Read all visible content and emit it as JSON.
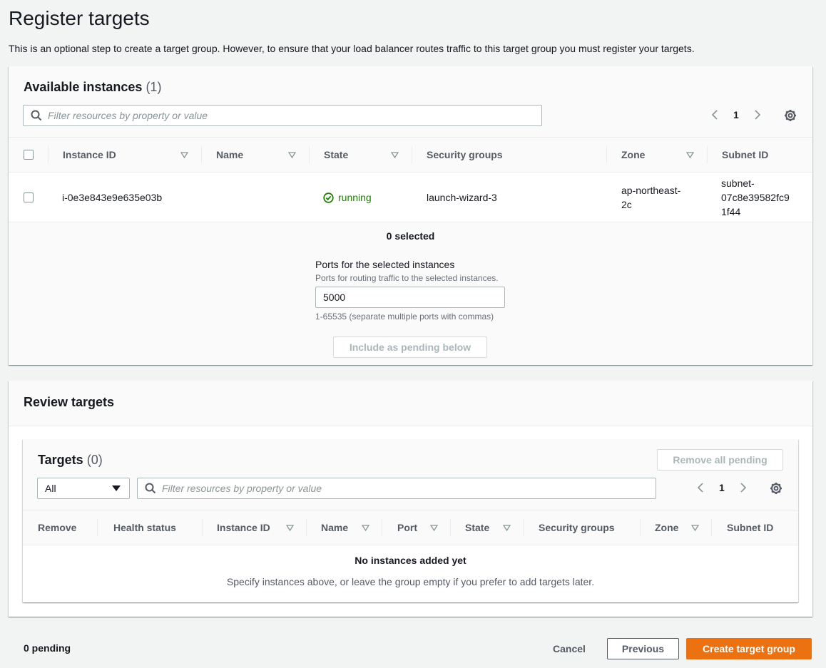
{
  "page": {
    "title": "Register targets",
    "description": "This is an optional step to create a target group. However, to ensure that your load balancer routes traffic to this target group you must register your targets."
  },
  "available": {
    "title": "Available instances",
    "count": "(1)",
    "filter_placeholder": "Filter resources by property or value",
    "page_number": "1",
    "columns": [
      "Instance ID",
      "Name",
      "State",
      "Security groups",
      "Zone",
      "Subnet ID"
    ],
    "rows": [
      {
        "instance_id": "i-0e3e843e9e635e03b",
        "name": "",
        "state": "running",
        "security_groups": "launch-wizard-3",
        "zone_line1": "ap-northeast-",
        "zone_line2": "2c",
        "subnet_line1": "subnet-",
        "subnet_line2": "07c8e39582fc9",
        "subnet_line3": "1f44"
      }
    ],
    "selected_text": "0 selected",
    "ports_label": "Ports for the selected instances",
    "ports_desc": "Ports for routing traffic to the selected instances.",
    "ports_value": "5000",
    "ports_hint": "1-65535 (separate multiple ports with commas)",
    "include_button": "Include as pending below"
  },
  "review": {
    "title": "Review targets",
    "targets_title": "Targets",
    "targets_count": "(0)",
    "remove_all_button": "Remove all pending",
    "select_value": "All",
    "filter_placeholder": "Filter resources by property or value",
    "page_number": "1",
    "columns": [
      "Remove",
      "Health status",
      "Instance ID",
      "Name",
      "Port",
      "State",
      "Security groups",
      "Zone",
      "Subnet ID"
    ],
    "empty_title": "No instances added yet",
    "empty_desc": "Specify instances above, or leave the group empty if you prefer to add targets later."
  },
  "footer": {
    "pending": "0 pending",
    "cancel": "Cancel",
    "previous": "Previous",
    "create": "Create target group"
  },
  "colors": {
    "primary": "#ec7211",
    "success": "#1d8102",
    "background": "#f2f3f3"
  }
}
